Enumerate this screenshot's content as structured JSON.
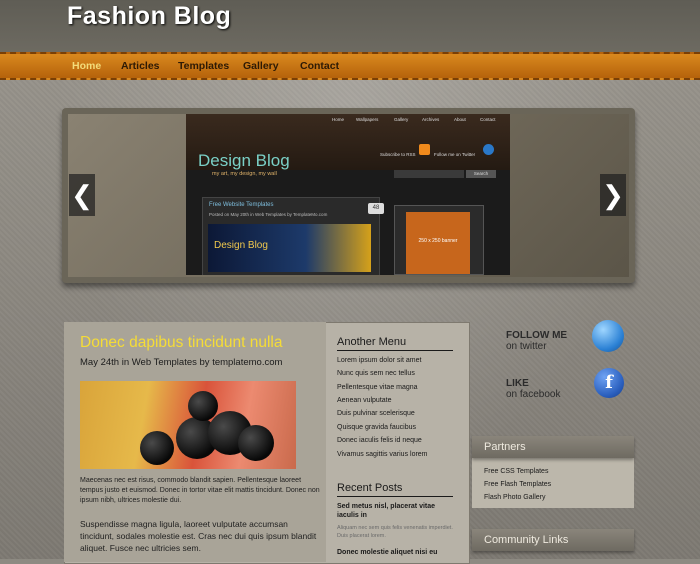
{
  "site": {
    "title": "Fashion Blog"
  },
  "nav": {
    "items": [
      "Home",
      "Articles",
      "Templates",
      "Gallery",
      "Contact"
    ],
    "active": "Home"
  },
  "slider": {
    "prev_icon": "chevron-left-icon",
    "next_icon": "chevron-right-icon",
    "screenshot": {
      "nav": [
        "Home",
        "Wallpapers",
        "Gallery",
        "Archives",
        "About",
        "Contact"
      ],
      "logo": "Design Blog",
      "tagline": "my art, my design, my wall",
      "subscribe": "Subscribe to RSS",
      "follow": "Follow me on Twitter",
      "search_button": "Search",
      "post_title": "Free Website Templates",
      "post_meta": "Posted on May 20th in Web Templates by TemplateMo.com",
      "comment_count": "48",
      "image_text": "Design Blog",
      "banner": "250 x 250 banner"
    }
  },
  "post": {
    "title": "Donec dapibus tincidunt nulla",
    "meta": "May 24th in Web Templates by templatemo.com",
    "p1": "Maecenas nec est risus, commodo blandit sapien. Pellentesque laoreet tempus justo et euismod. Donec in tortor vitae elit mattis tincidunt. Donec non ipsum nibh, ultrices molestie dui.",
    "p2": "Suspendisse magna ligula, laoreet vulputate accumsan tincidunt, sodales molestie est. Cras nec dui quis ipsum blandit aliquet. Fusce nec ultricies sem."
  },
  "another_menu": {
    "title": "Another Menu",
    "items": [
      "Lorem ipsum dolor sit amet",
      "Nunc quis sem nec tellus",
      "Pellentesque vitae magna",
      "Aenean vulputate",
      "Duis pulvinar scelerisque",
      "Quisque gravida faucibus",
      "Donec iaculis felis id neque",
      "Vivamus sagittis varius lorem"
    ]
  },
  "recent_posts": {
    "title": "Recent Posts",
    "items": [
      {
        "title": "Sed metus nisl, placerat vitae iaculis in",
        "excerpt": "Aliquam nec sem quis felis venenatis imperdiet. Duis placerat lorem."
      },
      {
        "title": "Donec molestie aliquet nisi eu",
        "excerpt": ""
      }
    ]
  },
  "social": {
    "twitter": {
      "big": "FOLLOW ME",
      "small": "on twitter",
      "icon": "twitter-bird-icon"
    },
    "facebook": {
      "big": "LIKE",
      "small": "on facebook",
      "icon": "facebook-icon",
      "glyph": "f"
    }
  },
  "partners": {
    "title": "Partners",
    "items": [
      "Free CSS Templates",
      "Free Flash Templates",
      "Flash Photo Gallery"
    ]
  },
  "community": {
    "title": "Community Links"
  },
  "colors": {
    "nav_orange": "#d9891e",
    "title_yellow": "#f5dc36",
    "accent_blue": "#2a80d4"
  }
}
